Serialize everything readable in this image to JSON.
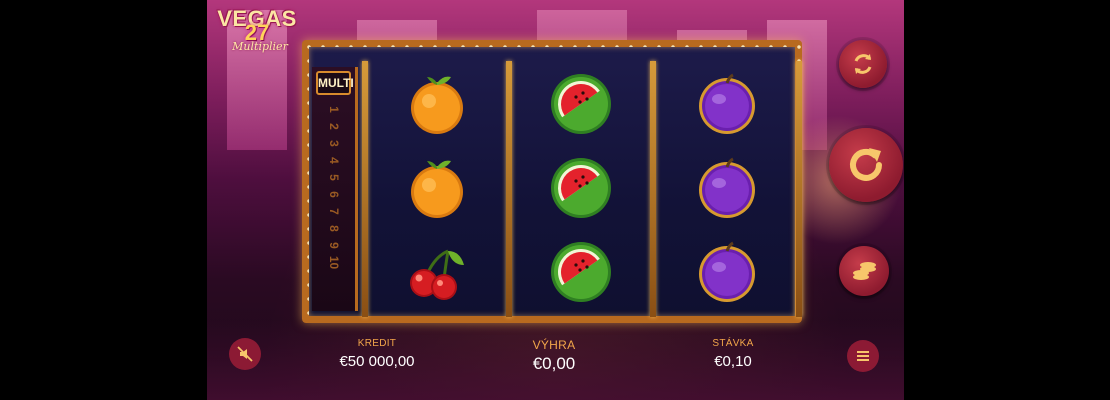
{
  "game": {
    "logo": {
      "line1": "VEGAS",
      "line2": "27",
      "line3": "Multiplier"
    },
    "multiplier": {
      "title": "MULTI",
      "values": [
        "1",
        "2",
        "3",
        "4",
        "5",
        "6",
        "7",
        "8",
        "9",
        "10"
      ]
    },
    "reels": [
      [
        "orange",
        "orange",
        "cherries"
      ],
      [
        "watermelon",
        "watermelon",
        "watermelon"
      ],
      [
        "plum",
        "plum",
        "plum"
      ]
    ],
    "buttons": {
      "autoplay_icon": "autoplay-icon",
      "spin_icon": "spin-icon",
      "bet_icon": "coins-icon",
      "sound_icon": "sound-off-icon",
      "menu_icon": "menu-icon"
    },
    "info": {
      "kredit_label": "KREDIT",
      "kredit_value": "€50 000,00",
      "vyhra_label": "VÝHRA",
      "vyhra_value": "€0,00",
      "stavka_label": "STÁVKA",
      "stavka_value": "€0,10"
    },
    "colors": {
      "accent_gold": "#d88b2d",
      "button_red": "#8e1b2f",
      "label_orange": "#f2a64a"
    }
  }
}
